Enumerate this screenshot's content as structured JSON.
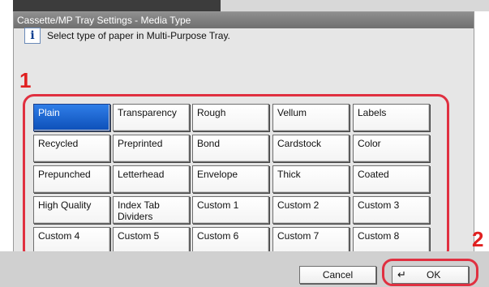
{
  "window": {
    "title": "Cassette/MP Tray Settings - Media Type"
  },
  "info": {
    "icon": "info-icon",
    "message": "Select type of paper in Multi-Purpose Tray."
  },
  "callouts": {
    "one": "1",
    "two": "2"
  },
  "media_types": [
    {
      "label": "Plain",
      "selected": true
    },
    {
      "label": "Transparency"
    },
    {
      "label": "Rough"
    },
    {
      "label": "Vellum"
    },
    {
      "label": "Labels"
    },
    {
      "label": "Recycled"
    },
    {
      "label": "Preprinted"
    },
    {
      "label": "Bond"
    },
    {
      "label": "Cardstock"
    },
    {
      "label": "Color"
    },
    {
      "label": "Prepunched"
    },
    {
      "label": "Letterhead"
    },
    {
      "label": "Envelope"
    },
    {
      "label": "Thick"
    },
    {
      "label": "Coated"
    },
    {
      "label": "High Quality"
    },
    {
      "label": "Index Tab Dividers"
    },
    {
      "label": "Custom 1"
    },
    {
      "label": "Custom 2"
    },
    {
      "label": "Custom 3"
    },
    {
      "label": "Custom 4"
    },
    {
      "label": "Custom 5"
    },
    {
      "label": "Custom 6"
    },
    {
      "label": "Custom 7"
    },
    {
      "label": "Custom 8"
    }
  ],
  "footer": {
    "cancel_label": "Cancel",
    "ok_label": "OK",
    "ok_icon": "enter-return-icon"
  },
  "colors": {
    "selected": "#1560d0",
    "callout": "#e02020"
  }
}
